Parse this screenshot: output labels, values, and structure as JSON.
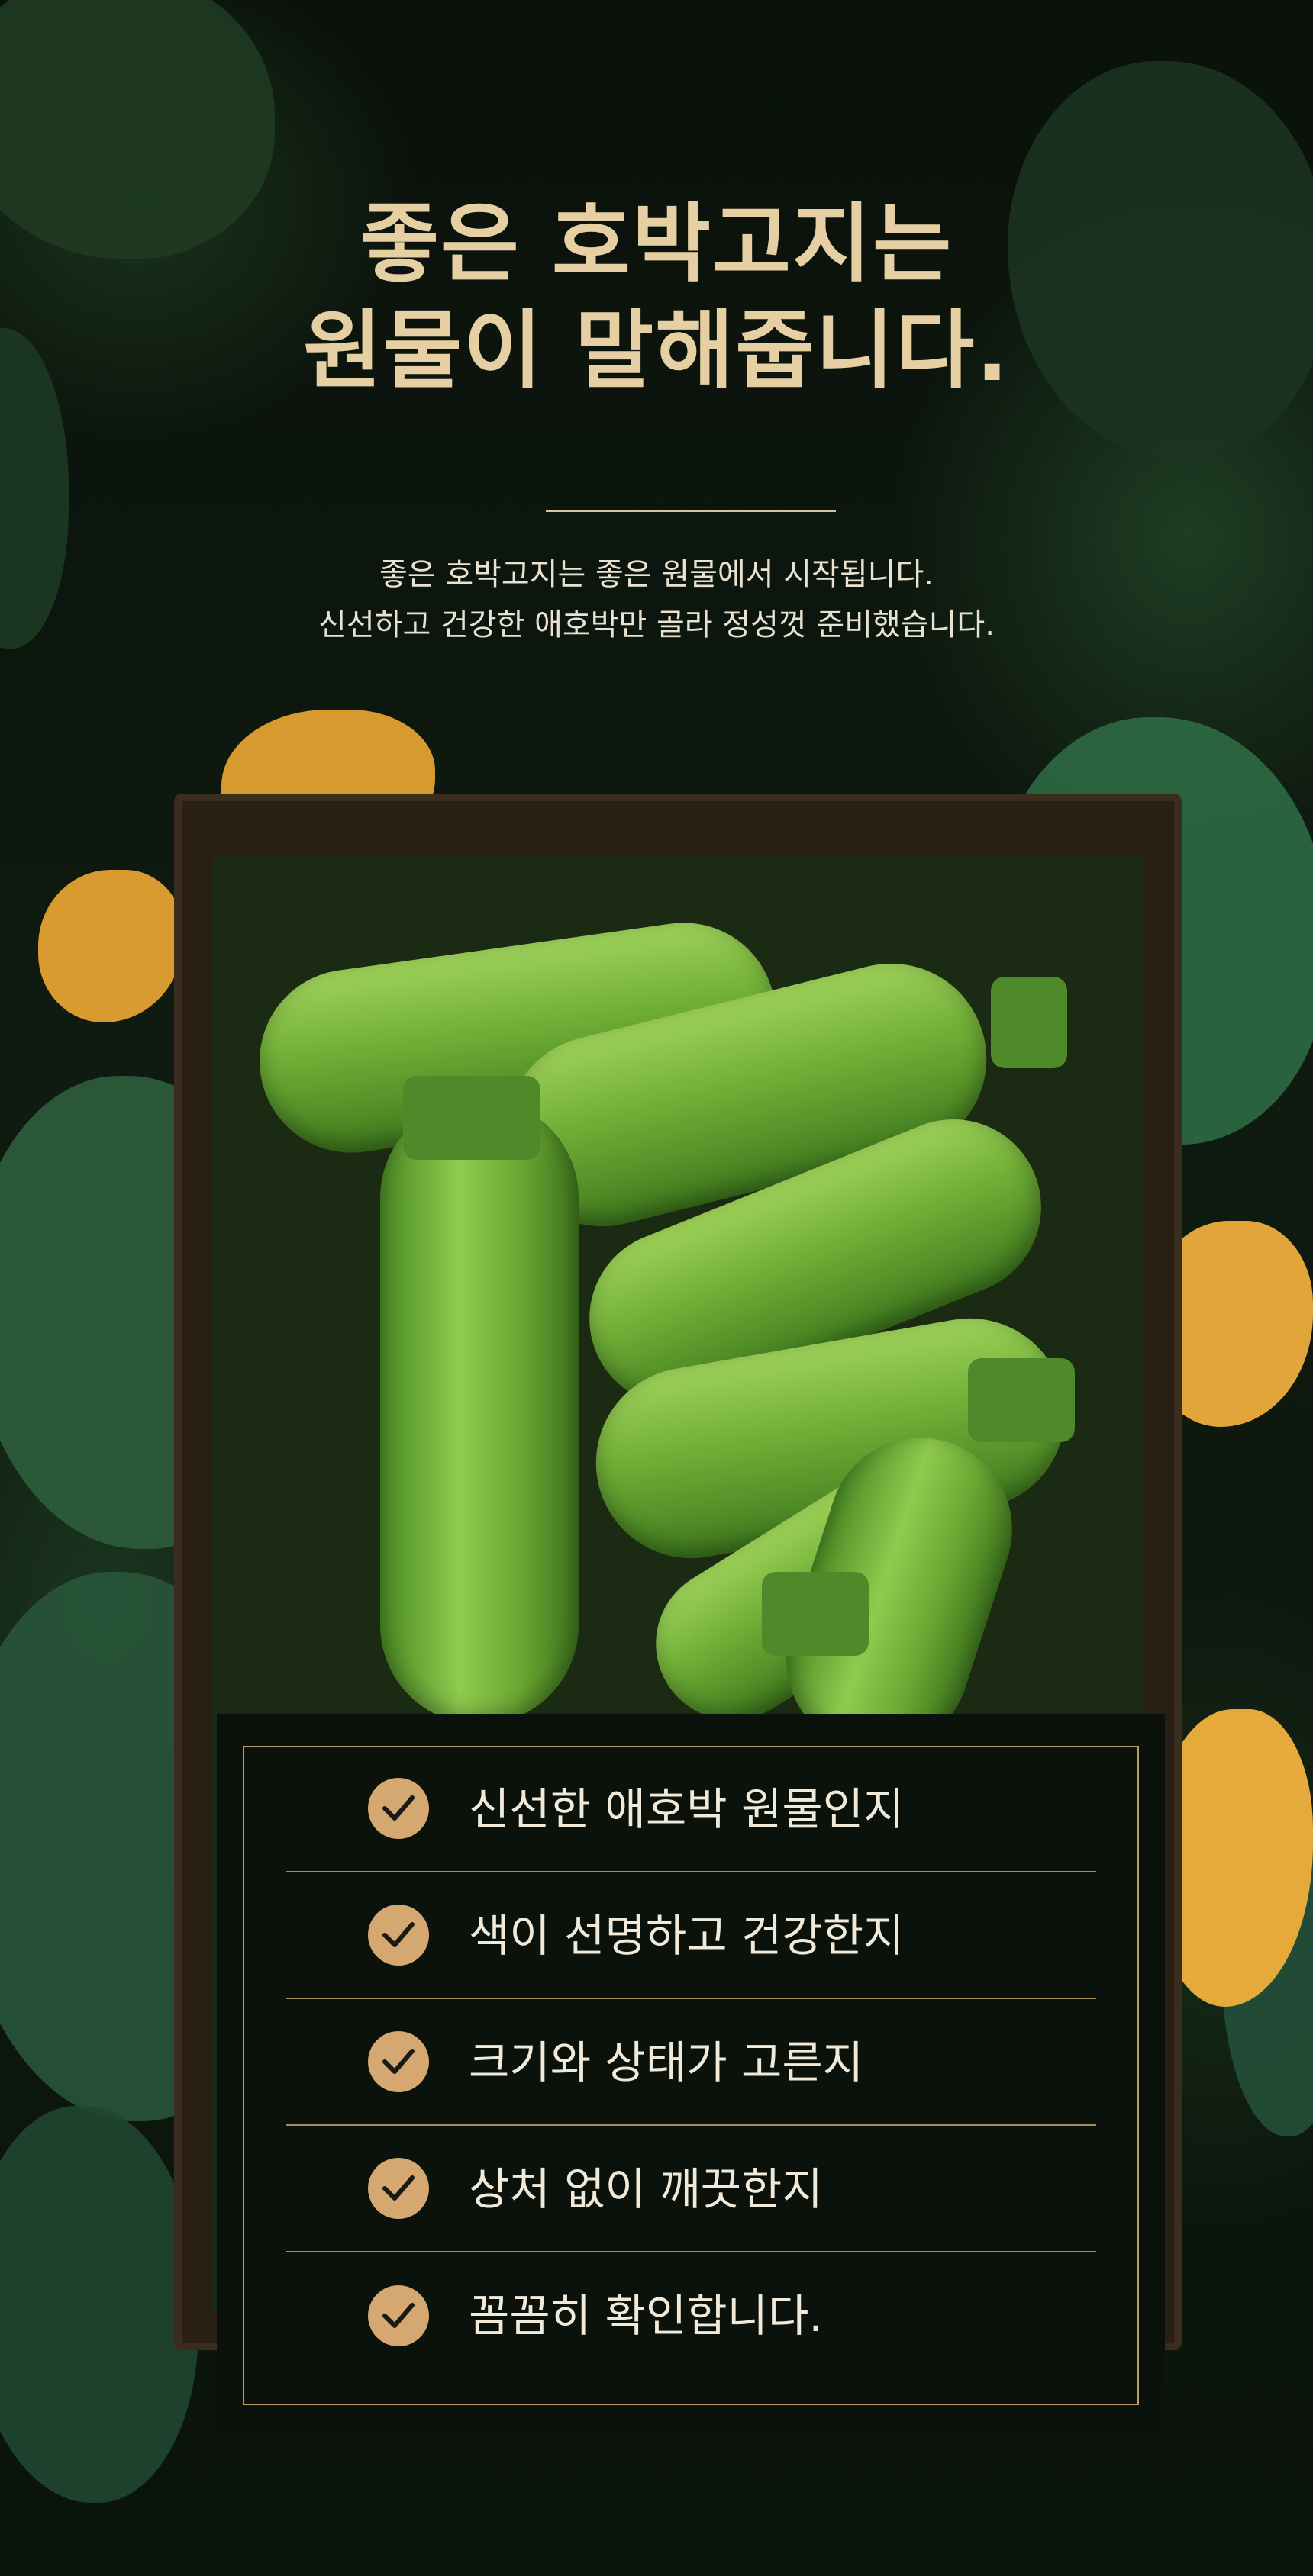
{
  "headline": {
    "line1": "좋은 호박고지는",
    "line2": "원물이 말해줍니다."
  },
  "intro": {
    "line1": "좋은 호박고지는 좋은 원물에서 시작됩니다.",
    "line2": "신선하고 건강한 애호박만 골라 정성껏 준비했습니다."
  },
  "checklist": [
    {
      "label": "신선한 애호박 원물인지",
      "icon": "check-icon"
    },
    {
      "label": "색이 선명하고 건강한지",
      "icon": "check-icon"
    },
    {
      "label": "크기와 상태가 고른지",
      "icon": "check-icon"
    },
    {
      "label": "상처 없이 깨끗한지",
      "icon": "check-icon"
    },
    {
      "label": "꼼꼼히 확인합니다.",
      "icon": "check-icon"
    }
  ],
  "colors": {
    "accent_gold": "#d4a870",
    "headline": "#e6cfa3",
    "panel_bg": "#0b110b",
    "background": "#0d150d"
  }
}
